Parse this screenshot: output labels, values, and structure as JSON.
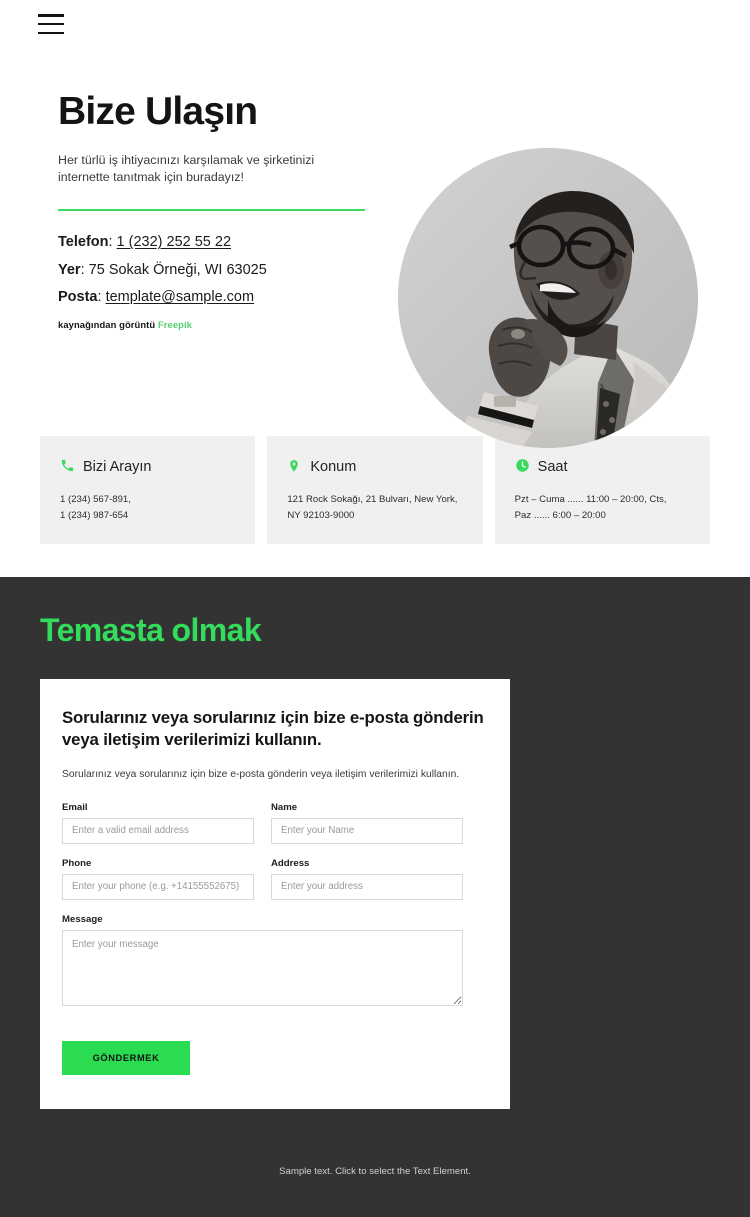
{
  "header": {
    "menu_icon": "hamburger-menu-icon"
  },
  "hero": {
    "title": "Bize Ulaşın",
    "subtitle": "Her türlü iş ihtiyacınızı karşılamak ve şirketinizi internette tanıtmak için buradayız!",
    "contact": [
      {
        "key": "Telefon",
        "sep": ": ",
        "value": "1 (232) 252 55 22",
        "link": true
      },
      {
        "key": "Yer",
        "sep": ": ",
        "value": "75 Sokak Örneği, WI 63025",
        "link": false
      },
      {
        "key": "Posta",
        "sep": ": ",
        "value": "template@sample.com",
        "link": true
      }
    ],
    "credit_text": "kaynağından görüntü",
    "credit_link": "Freepik",
    "photo_alt": "portrait-photo"
  },
  "cards": [
    {
      "icon": "phone-icon",
      "title": "Bizi Arayın",
      "lines": [
        "1 (234) 567-891,",
        "1 (234) 987-654"
      ]
    },
    {
      "icon": "map-pin-icon",
      "title": "Konum",
      "lines": [
        "121 Rock Sokağı, 21 Bulvarı, New York,",
        "NY 92103-9000"
      ]
    },
    {
      "icon": "clock-icon",
      "title": "Saat",
      "lines": [
        "Pzt – Cuma ...... 11:00 – 20:00, Cts,",
        "Paz  ...... 6:00 – 20:00"
      ]
    }
  ],
  "dark_section": {
    "title": "Temasta olmak",
    "form": {
      "heading_line1": "Sorularınız veya sorularınız için bize e-posta gönderin",
      "heading_line2": "veya iletişim verilerimizi kullanın.",
      "paragraph": "Sorularınız veya sorularınız için bize e-posta gönderin veya iletişim verilerimizi kullanın.",
      "fields": {
        "email": {
          "label": "Email",
          "placeholder": "Enter a valid email address",
          "value": ""
        },
        "name": {
          "label": "Name",
          "placeholder": "Enter your Name",
          "value": ""
        },
        "phone": {
          "label": "Phone",
          "placeholder": "Enter your phone (e.g. +14155552675)",
          "value": ""
        },
        "address": {
          "label": "Address",
          "placeholder": "Enter your address",
          "value": ""
        },
        "message": {
          "label": "Message",
          "placeholder": "Enter your message",
          "value": ""
        }
      },
      "submit_label": "GÖNDERMEK"
    },
    "footer_text": "Sample text. Click to select the Text Element."
  },
  "colors": {
    "accent_green": "#2cdc50",
    "title_green": "#33dd5b",
    "rule_green": "#3ddc61",
    "dark_bg": "#333333",
    "card_bg": "#f0f0f0"
  }
}
